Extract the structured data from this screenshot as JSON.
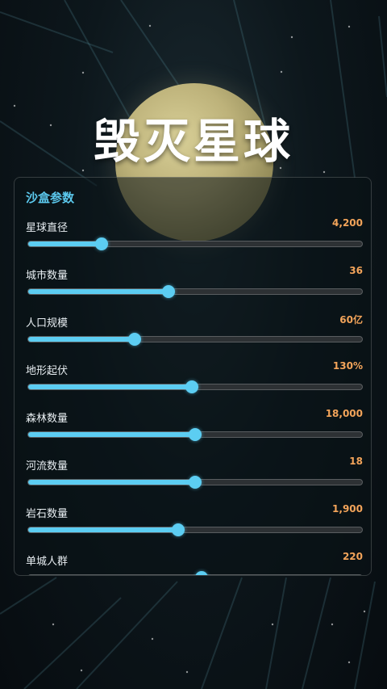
{
  "title": "毁灭星球",
  "panel": {
    "title": "沙盒参数",
    "params": [
      {
        "label": "星球直径",
        "value": "4,200",
        "level": 0.22
      },
      {
        "label": "城市数量",
        "value": "36",
        "level": 0.42
      },
      {
        "label": "人口规模",
        "value": "60亿",
        "level": 0.32
      },
      {
        "label": "地形起伏",
        "value": "130%",
        "level": 0.49
      },
      {
        "label": "森林数量",
        "value": "18,000",
        "level": 0.5
      },
      {
        "label": "河流数量",
        "value": "18",
        "level": 0.5
      },
      {
        "label": "岩石数量",
        "value": "1,900",
        "level": 0.45
      },
      {
        "label": "单城人群",
        "value": "220",
        "level": 0.52
      }
    ]
  },
  "colors": {
    "accent": "#5ccdf2",
    "value": "#f3a45a",
    "planet": "#bdb27a"
  }
}
